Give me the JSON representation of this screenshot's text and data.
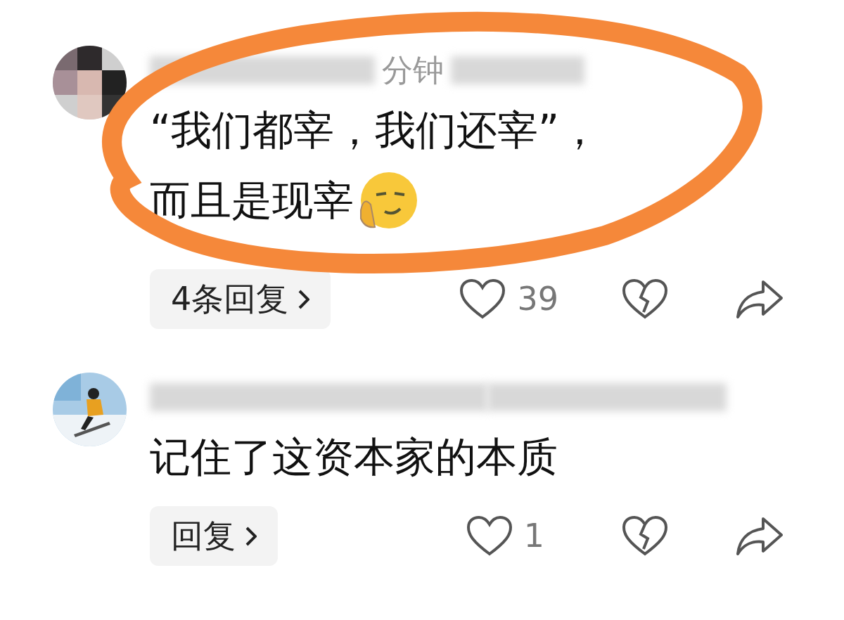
{
  "comments": [
    {
      "avatar": {
        "kind": "person"
      },
      "time_fragment": "分钟",
      "lines": [
        "“我们都宰，我们还宰”，",
        "而且是现宰"
      ],
      "emoji": true,
      "reply_button": "4条回复",
      "likes": "39",
      "circled": true
    },
    {
      "avatar": {
        "kind": "picture"
      },
      "lines": [
        "记住了这资本家的本质"
      ],
      "reply_button": "回复",
      "likes": "1",
      "circled": false
    }
  ]
}
